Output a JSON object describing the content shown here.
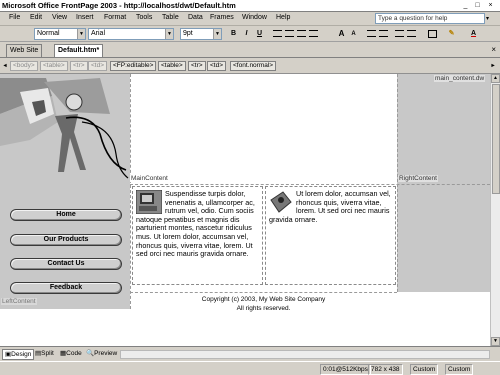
{
  "window": {
    "title": "Microsoft Office FrontPage 2003 - http://localhost/dwt/Default.htm",
    "minimize": "_",
    "maximize": "□",
    "close": "×"
  },
  "menu": {
    "items": [
      "File",
      "Edit",
      "View",
      "Insert",
      "Format",
      "Tools",
      "Table",
      "Data",
      "Frames",
      "Window",
      "Help"
    ],
    "help_placeholder": "Type a question for help",
    "help_dropdown": "▾"
  },
  "toolbar": {
    "style": "Normal",
    "font": "Arial",
    "size": "9pt",
    "bold": "B",
    "italic": "I",
    "underline": "U",
    "grow_font": "A",
    "shrink_font": "A",
    "font_color": "A"
  },
  "tabs": {
    "items": [
      "Web Site",
      "Default.htm*"
    ],
    "close": "×"
  },
  "tag_selector": [
    "<body>",
    "<table>",
    "<tr>",
    "<td>",
    "<FP:editable>",
    "<table>",
    "<tr>",
    "<td>",
    "<font.normal>"
  ],
  "page": {
    "region_main_content_dw": "main_content.dw",
    "region_main": "MainContent",
    "region_right": "RightContent",
    "region_left": "LeftContent",
    "nav_buttons": [
      "Home",
      "Our Products",
      "Contact Us",
      "Feedback"
    ],
    "cell_left_text": "Suspendisse turpis dolor, venenatis a, ullamcorper ac, rutrum vel, odio. Cum sociis natoque penatibus et magnis dis parturient montes, nascetur ridiculus mus. Ut lorem dolor, accumsan vel, rhoncus quis, viverra vitae, lorem. Ut sed orci nec mauris gravida ornare.",
    "cell_right_text": "Ut lorem dolor, accumsan vel, rhoncus quis, viverra vitae, lorem. Ut sed orci nec mauris gravida ornare.",
    "footer_line1": "Copyright (c) 2003, My Web Site Company",
    "footer_line2": "All rights reserved."
  },
  "views": [
    "Design",
    "Split",
    "Code",
    "Preview"
  ],
  "status": {
    "download": "0:01@512Kbps",
    "size": "782 x 438",
    "mode1": "Custom",
    "mode2": "Custom"
  },
  "colors": {
    "chrome": "#d4d0c8",
    "layout_gray": "#c8c8c8"
  }
}
